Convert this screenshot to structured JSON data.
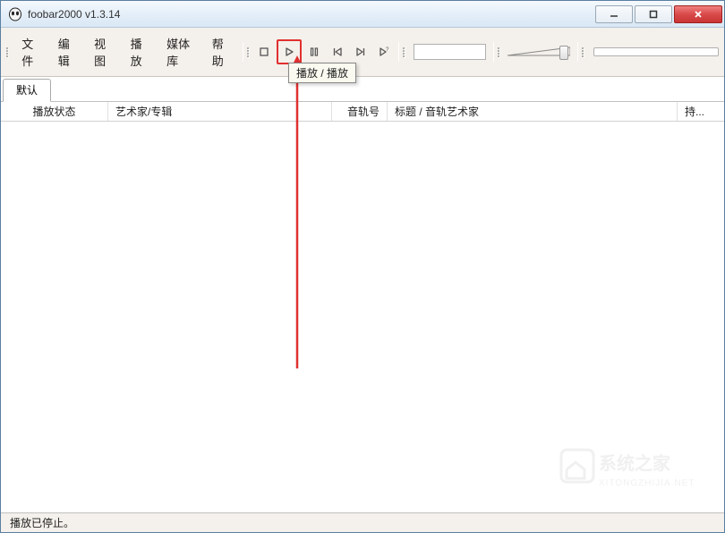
{
  "window": {
    "title": "foobar2000 v1.3.14"
  },
  "menu": {
    "items": [
      "文件",
      "编辑",
      "视图",
      "播放",
      "媒体库",
      "帮助"
    ]
  },
  "tooltip": {
    "text": "播放 / 播放"
  },
  "tabs": {
    "items": [
      "默认"
    ]
  },
  "columns": {
    "state": "播放状态",
    "artist": "艺术家/专辑",
    "trackno": "音轨号",
    "title": "标题 / 音轨艺术家",
    "duration": "持..."
  },
  "statusbar": {
    "text": "播放已停止。"
  },
  "watermark": {
    "line1": "系统之家",
    "line2": "XITONGZHIJIA.NET"
  }
}
